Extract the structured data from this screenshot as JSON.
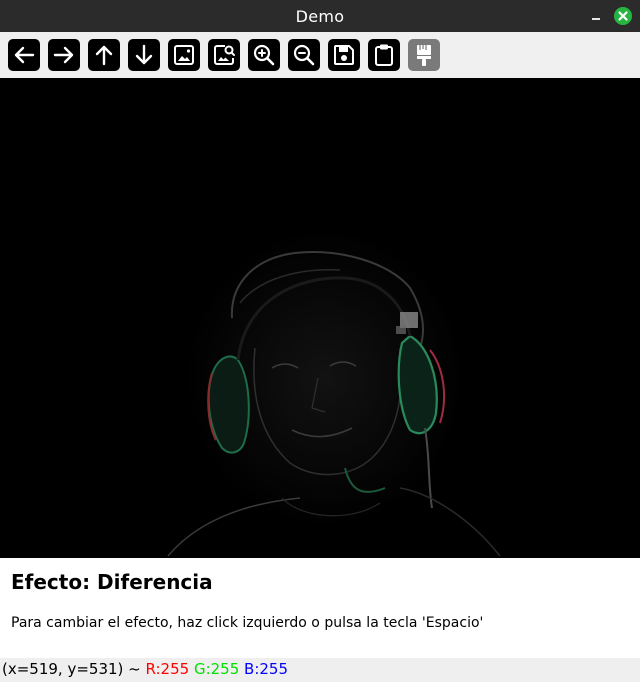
{
  "window": {
    "title": "Demo"
  },
  "toolbar": {
    "buttons": [
      {
        "icon": "arrow-left-icon"
      },
      {
        "icon": "arrow-right-icon"
      },
      {
        "icon": "arrow-up-icon"
      },
      {
        "icon": "arrow-down-icon"
      },
      {
        "icon": "image-icon"
      },
      {
        "icon": "image-search-icon"
      },
      {
        "icon": "zoom-in-icon"
      },
      {
        "icon": "zoom-out-icon"
      },
      {
        "icon": "save-icon"
      },
      {
        "icon": "clipboard-icon"
      },
      {
        "icon": "paint-brush-icon",
        "state": "disabled"
      }
    ]
  },
  "panel": {
    "title": "Efecto: Diferencia",
    "hint": "Para cambiar el efecto, haz click izquierdo o pulsa la tecla 'Espacio'"
  },
  "status": {
    "coords": "(x=519, y=531) ~",
    "r": "R:255",
    "g": "G:255",
    "b": "B:255"
  },
  "colors": {
    "titlebar": "#2b2b2b",
    "toolbar": "#f0f0f0",
    "close": "#28b440",
    "red": "#ff0000",
    "green": "#00e000",
    "blue": "#0000ff"
  }
}
